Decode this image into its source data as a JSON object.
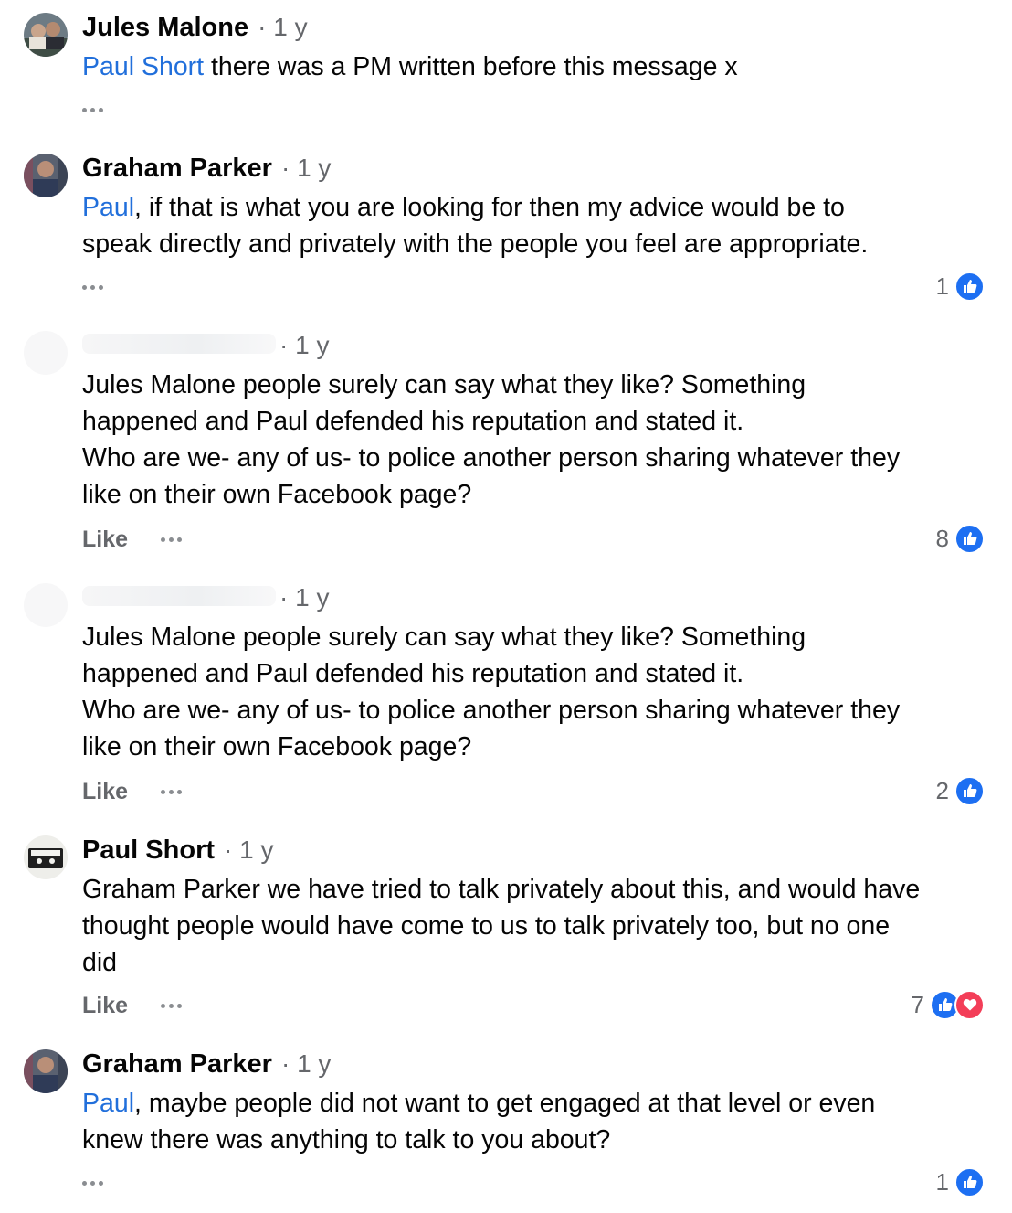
{
  "comments": [
    {
      "author": "Jules Malone",
      "time": "· 1 y",
      "mention": "Paul Short",
      "text": " there was a PM written before this message x",
      "like_label": "",
      "count": ""
    },
    {
      "author": "Graham Parker",
      "time": "· 1 y",
      "mention": "Paul",
      "text_line1": ", if that is what you are looking for then my advice would be to",
      "text_line2": "speak directly and privately with the people you feel are appropriate.",
      "count": "1"
    },
    {
      "author": "",
      "time": "· 1 y",
      "lines": [
        "Jules Malone people surely can say what they like? Something",
        "happened and Paul defended his reputation and stated it.",
        "Who are we- any of us- to police another person sharing whatever they",
        "like on their own Facebook page?"
      ],
      "like_label": "Like",
      "count": "8"
    },
    {
      "author": "",
      "time": "· 1 y",
      "lines": [
        "Jules Malone people surely can say what they like? Something",
        "happened and Paul defended his reputation and stated it.",
        "Who are we- any of us- to police another person sharing whatever they",
        "like on their own Facebook page?"
      ],
      "like_label": "Like",
      "count": "2"
    },
    {
      "author": "Paul Short",
      "time": "· 1 y",
      "lines": [
        "Graham Parker we have tried to talk privately about this, and would have",
        "thought people would have come to us to talk privately too, but no one",
        "did"
      ],
      "like_label": "Like",
      "count": "7"
    },
    {
      "author": "Graham Parker",
      "time": "· 1 y",
      "mention": "Paul",
      "text_line1": ", maybe people did not want to get engaged at that level or even",
      "text_line2": "knew there was anything to talk to you about?",
      "count": "1"
    }
  ],
  "colors": {
    "mention": "#216fdb",
    "like": "#1d6ff2",
    "love": "#f33e58",
    "secondary_text": "#65676b"
  }
}
